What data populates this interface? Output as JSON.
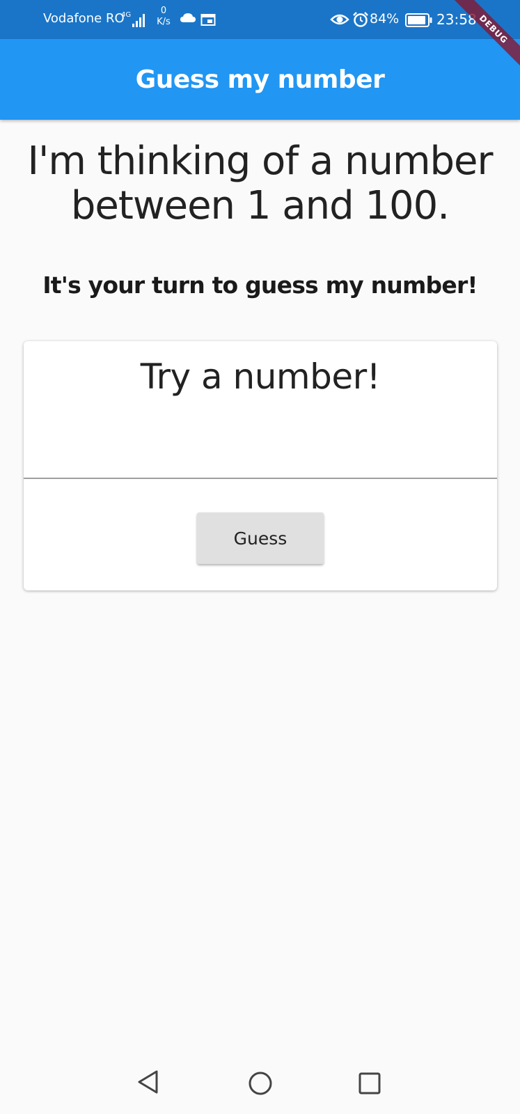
{
  "status_bar": {
    "carrier": "Vodafone RO",
    "network_type": "4G",
    "speed_value": "0",
    "speed_unit": "K/s",
    "battery_percent": "84%",
    "time": "23:58",
    "icons": [
      "signal-icon",
      "cloud-icon",
      "calendar-icon",
      "eye-icon",
      "alarm-icon",
      "battery-icon"
    ]
  },
  "debug_banner": "DEBUG",
  "app_bar": {
    "title": "Guess my number",
    "color": "#2196f3"
  },
  "main": {
    "intro_text": "I'm thinking of a number between 1 and 100.",
    "subtitle": "It's your turn to guess my number!"
  },
  "card": {
    "title": "Try a number!",
    "input_value": "",
    "button_label": "Guess"
  },
  "nav_bar": {
    "icons": [
      "back-icon",
      "home-icon",
      "recents-icon"
    ]
  }
}
